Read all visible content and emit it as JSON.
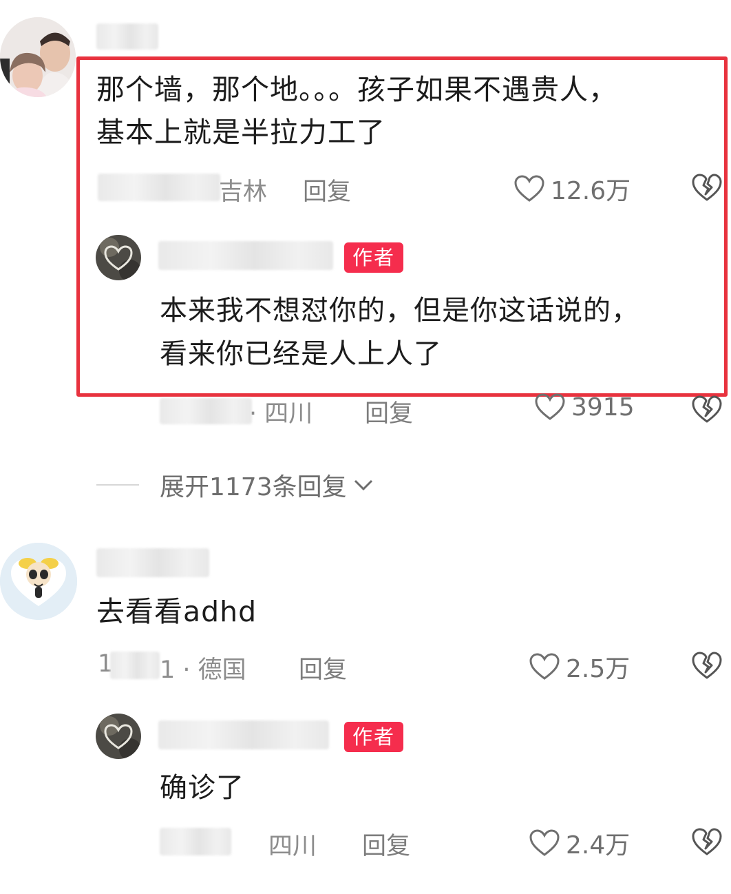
{
  "comments": [
    {
      "text_lines": [
        "那个墙，那个地。。。孩子如果不遇贵人，",
        "基本上就是半拉力工了"
      ],
      "location": "吉林",
      "reply_label": "回复",
      "likes": "12.6万",
      "reply": {
        "badge": "作者",
        "text_lines": [
          "本来我不想怼你的，但是你这话说的，",
          "看来你已经是人上人了"
        ],
        "meta": "· 四川",
        "reply_label": "回复",
        "likes": "3915"
      },
      "expand_label": "展开1173条回复"
    },
    {
      "text_lines": [
        "去看看adhd"
      ],
      "date_fragment_start": "1",
      "date_fragment_end": "1 · 德国",
      "reply_label": "回复",
      "likes": "2.5万",
      "reply": {
        "badge": "作者",
        "text_lines": [
          "确诊了"
        ],
        "meta": "四川",
        "reply_label": "回复",
        "likes": "2.4万"
      }
    }
  ],
  "colors": {
    "highlight_border": "#e8323e",
    "author_badge": "#f52d4d"
  }
}
